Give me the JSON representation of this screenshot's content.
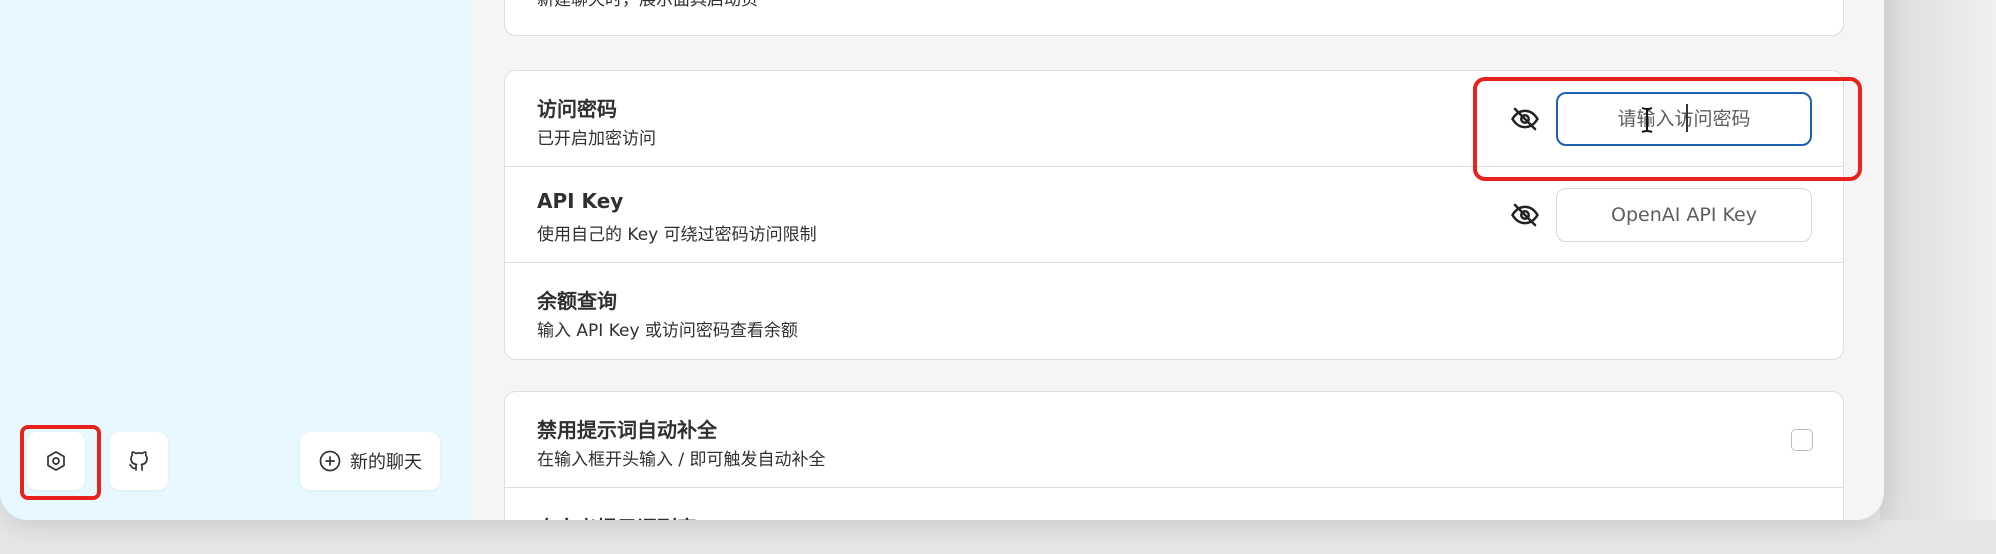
{
  "sidebar": {
    "settings_icon": "settings-icon",
    "github_icon": "github-icon",
    "new_chat_icon": "plus-circle-icon",
    "new_chat_label": "新的聊天"
  },
  "settings": {
    "mask_start": {
      "subtitle": "新建聊天时，展示面具启动页"
    },
    "access_code": {
      "title": "访问密码",
      "subtitle": "已开启加密访问",
      "placeholder": "请输入访问密码",
      "toggle_icon": "eye-off-icon"
    },
    "api_key": {
      "title": "API Key",
      "subtitle": "使用自己的 Key 可绕过密码访问限制",
      "placeholder": "OpenAI API Key",
      "toggle_icon": "eye-off-icon"
    },
    "balance": {
      "title": "余额查询",
      "subtitle": "输入 API Key 或访问密码查看余额"
    },
    "disable_autocomplete": {
      "title": "禁用提示词自动补全",
      "subtitle": "在输入框开头输入 / 即可触发自动补全"
    },
    "custom_prompts": {
      "title": "自定义提示词列表"
    }
  },
  "colors": {
    "highlight": "#e8231e",
    "focus_border": "#1d5fb0",
    "sidebar_bg": "#e7f8ff",
    "main_bg": "#f5f5f5"
  }
}
